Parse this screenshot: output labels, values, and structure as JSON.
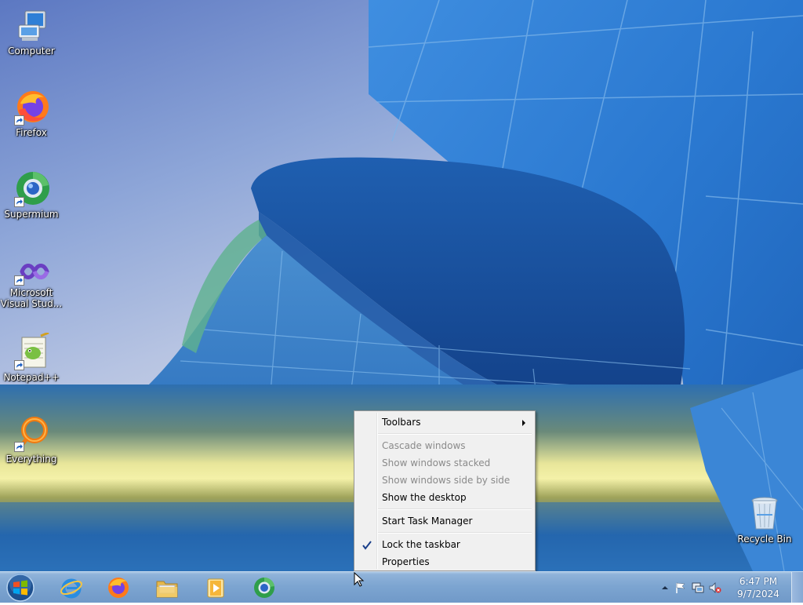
{
  "desktop": {
    "icons": [
      {
        "label": "Computer",
        "icon": "computer-icon"
      },
      {
        "label": "Firefox",
        "icon": "firefox-icon"
      },
      {
        "label": "Supermium",
        "icon": "supermium-icon"
      },
      {
        "label_line1": "Microsoft",
        "label_line2": "Visual Stud...",
        "icon": "visual-studio-icon"
      },
      {
        "label": "Notepad++",
        "icon": "notepadpp-icon"
      },
      {
        "label": "Everything",
        "icon": "everything-icon"
      },
      {
        "label": "Recycle Bin",
        "icon": "recycle-bin-icon"
      }
    ]
  },
  "context_menu": {
    "items": [
      {
        "label": "Toolbars",
        "enabled": true,
        "submenu": true
      },
      {
        "label": "Cascade windows",
        "enabled": false
      },
      {
        "label": "Show windows stacked",
        "enabled": false
      },
      {
        "label": "Show windows side by side",
        "enabled": false
      },
      {
        "label": "Show the desktop",
        "enabled": true
      },
      {
        "label": "Start Task Manager",
        "enabled": true
      },
      {
        "label": "Lock the taskbar",
        "enabled": true,
        "checked": true
      },
      {
        "label": "Properties",
        "enabled": true
      }
    ]
  },
  "taskbar": {
    "pinned": [
      "start-orb-icon",
      "internet-explorer-icon",
      "firefox-icon",
      "file-explorer-icon",
      "media-player-icon",
      "supermium-icon"
    ],
    "tray": {
      "icons": [
        "show-hidden-icons-arrow",
        "action-center-flag-icon",
        "network-icon",
        "volume-muted-icon"
      ],
      "time": "6:47 PM",
      "date": "9/7/2024"
    }
  },
  "colors": {
    "taskbar": "#7da5d1",
    "menu_bg": "#f0f0f0",
    "disabled_text": "#8a8a8a"
  }
}
